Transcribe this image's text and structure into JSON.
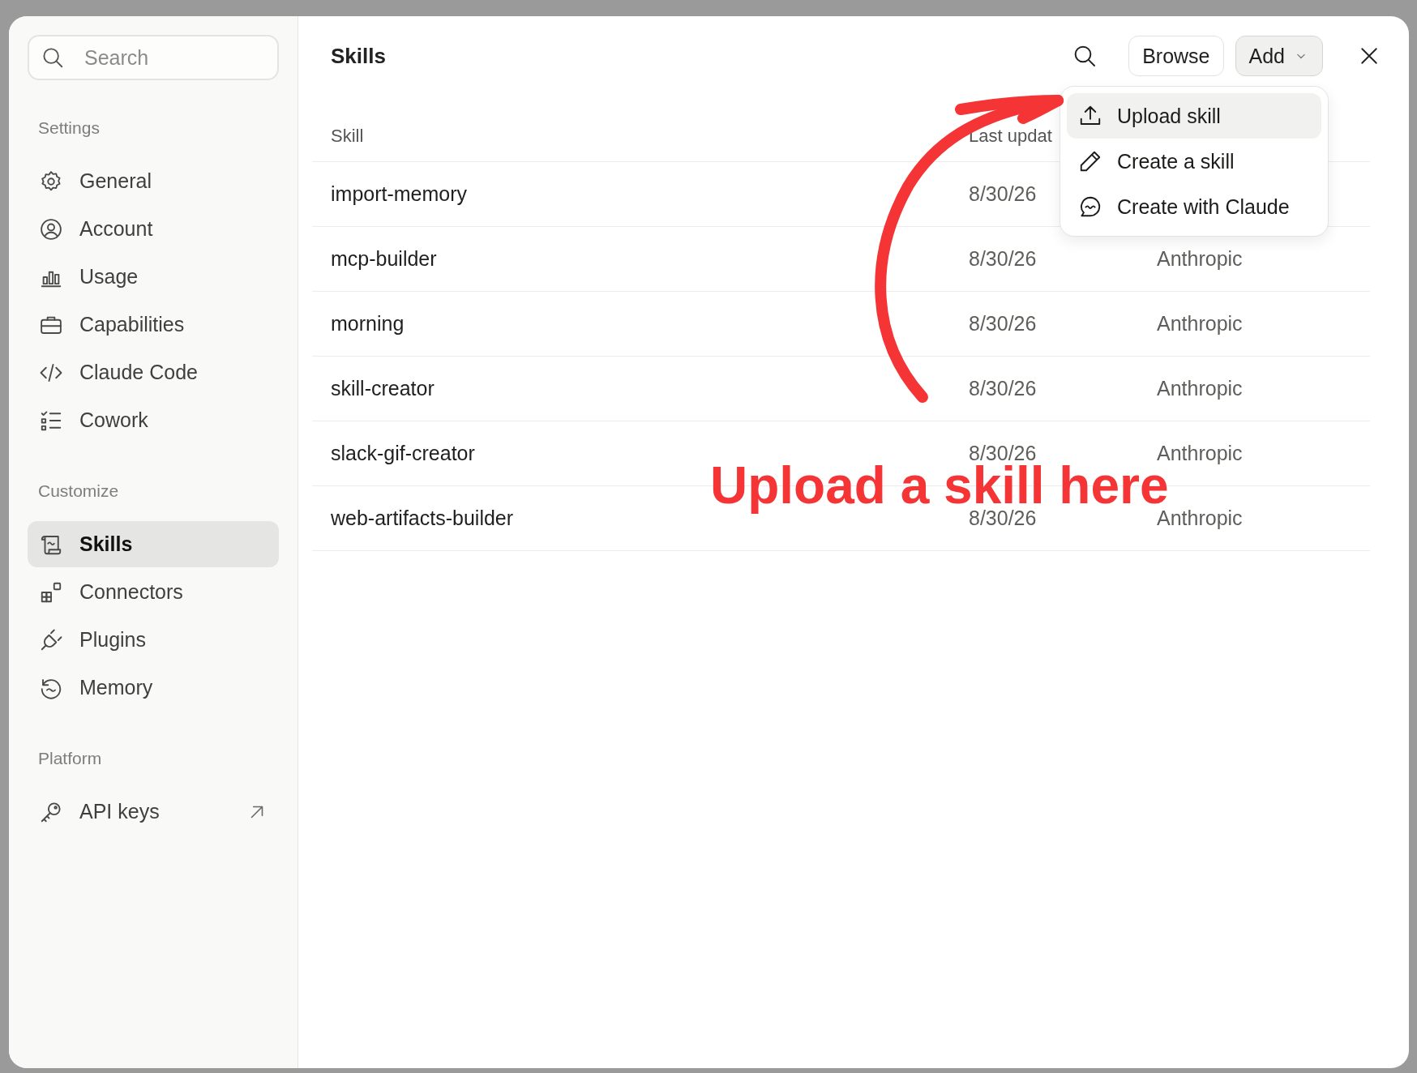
{
  "sidebar": {
    "search": {
      "placeholder": "Search"
    },
    "sections": [
      {
        "title": "Settings",
        "items": [
          {
            "label": "General",
            "selected": false,
            "external": false
          },
          {
            "label": "Account",
            "selected": false,
            "external": false
          },
          {
            "label": "Usage",
            "selected": false,
            "external": false
          },
          {
            "label": "Capabilities",
            "selected": false,
            "external": false
          },
          {
            "label": "Claude Code",
            "selected": false,
            "external": false
          },
          {
            "label": "Cowork",
            "selected": false,
            "external": false
          }
        ]
      },
      {
        "title": "Customize",
        "items": [
          {
            "label": "Skills",
            "selected": true,
            "external": false
          },
          {
            "label": "Connectors",
            "selected": false,
            "external": false
          },
          {
            "label": "Plugins",
            "selected": false,
            "external": false
          },
          {
            "label": "Memory",
            "selected": false,
            "external": false
          }
        ]
      },
      {
        "title": "Platform",
        "items": [
          {
            "label": "API keys",
            "selected": false,
            "external": true
          }
        ]
      }
    ]
  },
  "main": {
    "title": "Skills",
    "toolbar": {
      "buttons": [
        {
          "label": "Browse",
          "kind": "plain",
          "open": false
        },
        {
          "label": "Add",
          "kind": "dropdown",
          "open": true
        }
      ]
    },
    "menu": {
      "items": [
        {
          "label": "Upload skill",
          "selected": true
        },
        {
          "label": "Create a skill",
          "selected": false
        },
        {
          "label": "Create with Claude",
          "selected": false
        }
      ]
    },
    "table": {
      "columns": [
        "Skill",
        "Last updat"
      ],
      "rows": [
        {
          "skill": "import-memory",
          "date": "8/30/26"
        },
        {
          "skill": "mcp-builder",
          "date": "8/30/26",
          "author": "Anthropic"
        },
        {
          "skill": "morning",
          "date": "8/30/26",
          "author": "Anthropic"
        },
        {
          "skill": "skill-creator",
          "date": "8/30/26",
          "author": "Anthropic"
        },
        {
          "skill": "slack-gif-creator",
          "date": "8/30/26",
          "author": "Anthropic"
        },
        {
          "skill": "web-artifacts-builder",
          "date": "8/30/26",
          "author": "Anthropic"
        }
      ]
    }
  },
  "annotation": {
    "text": "Upload a skill here"
  }
}
